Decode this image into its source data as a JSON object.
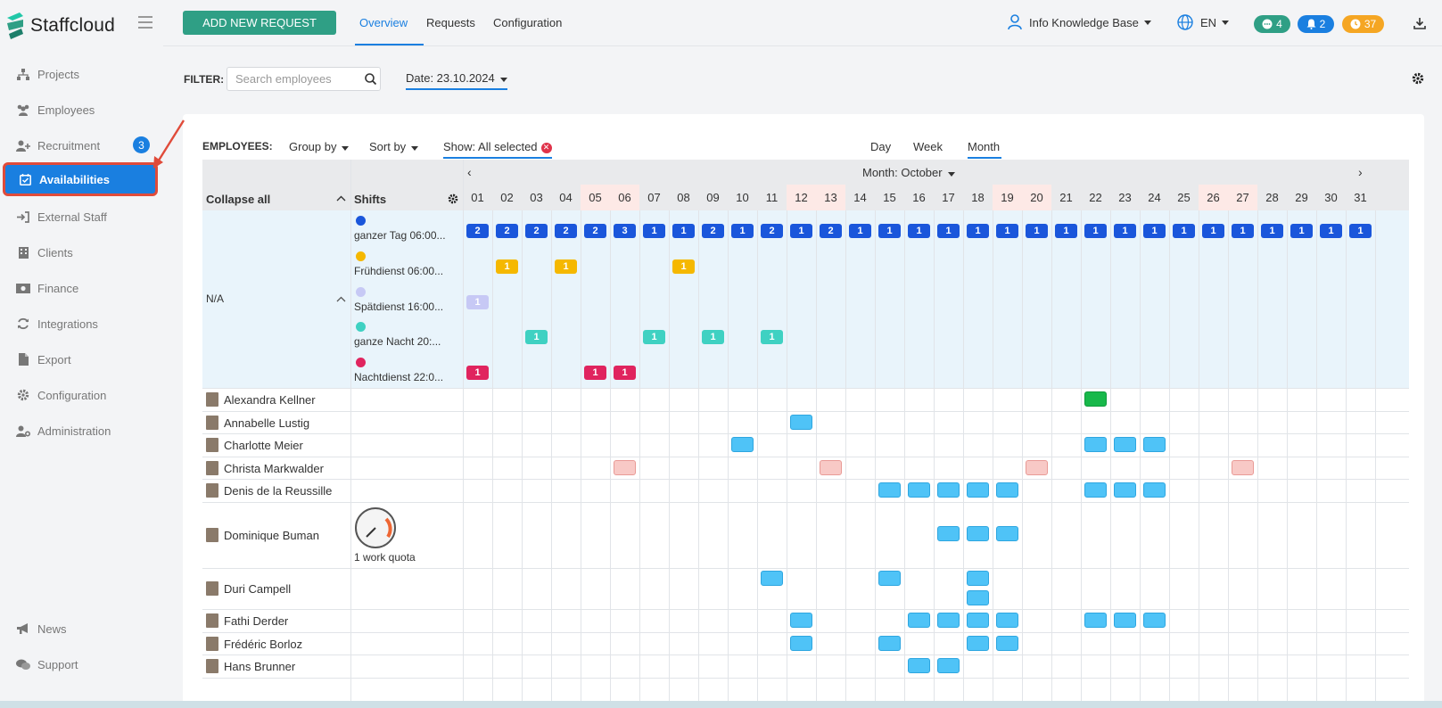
{
  "app": {
    "name": "Staffcloud"
  },
  "sidebar": {
    "items": [
      {
        "label": "Projects",
        "icon": "sitemap-icon"
      },
      {
        "label": "Employees",
        "icon": "users-icon"
      },
      {
        "label": "Recruitment",
        "icon": "user-plus-icon",
        "badge": "3"
      },
      {
        "label": "Availabilities",
        "icon": "calendar-check-icon",
        "active": true
      },
      {
        "label": "External Staff",
        "icon": "sign-in-icon"
      },
      {
        "label": "Clients",
        "icon": "building-icon"
      },
      {
        "label": "Finance",
        "icon": "money-icon"
      },
      {
        "label": "Integrations",
        "icon": "refresh-icon"
      },
      {
        "label": "Export",
        "icon": "file-icon"
      },
      {
        "label": "Configuration",
        "icon": "gear-icon"
      },
      {
        "label": "Administration",
        "icon": "user-gear-icon"
      }
    ],
    "bottom_items": [
      {
        "label": "News",
        "icon": "bullhorn-icon"
      },
      {
        "label": "Support",
        "icon": "comments-icon"
      }
    ]
  },
  "topbar": {
    "add_button": "ADD NEW REQUEST",
    "tabs": [
      "Overview",
      "Requests",
      "Configuration"
    ],
    "active_tab": "Overview",
    "user": "Info Knowledge Base",
    "language": "EN",
    "messages_count": "4",
    "notifications_count": "2",
    "timers_count": "37",
    "colors": {
      "messages": "#2f9f85",
      "notifications": "#1a7fe0",
      "timers": "#f5a623"
    }
  },
  "filter": {
    "label": "FILTER:",
    "search_placeholder": "Search employees",
    "date": "Date: 23.10.2024"
  },
  "toolbar": {
    "employees_label": "EMPLOYEES:",
    "group_by": "Group by",
    "sort_by": "Sort by",
    "show_label": "Show:",
    "show_value": "All selected",
    "views": [
      "Day",
      "Week",
      "Month"
    ],
    "active_view": "Month"
  },
  "calendar": {
    "collapse_all": "Collapse all",
    "shifts_label": "Shifts",
    "month_title": "Month: October",
    "days": [
      "01",
      "02",
      "03",
      "04",
      "05",
      "06",
      "07",
      "08",
      "09",
      "10",
      "11",
      "12",
      "13",
      "14",
      "15",
      "16",
      "17",
      "18",
      "19",
      "20",
      "21",
      "22",
      "23",
      "24",
      "25",
      "26",
      "27",
      "28",
      "29",
      "30",
      "31"
    ],
    "weekend_days": [
      "05",
      "06",
      "12",
      "13",
      "19",
      "20",
      "26",
      "27"
    ],
    "group_label": "N/A",
    "shifts": [
      {
        "name": "ganzer Tag 06:00...",
        "color": "#1a56db",
        "counts": [
          "2",
          "2",
          "2",
          "2",
          "2",
          "3",
          "1",
          "1",
          "2",
          "1",
          "2",
          "1",
          "2",
          "1",
          "1",
          "1",
          "1",
          "1",
          "1",
          "1",
          "1",
          "1",
          "1",
          "1",
          "1",
          "1",
          "1",
          "1",
          "1",
          "1",
          "1"
        ]
      },
      {
        "name": "Frühdienst 06:00...",
        "color": "#f5b800",
        "counts": [
          "",
          "1",
          "",
          "1",
          "",
          "",
          "",
          "1",
          "",
          "",
          "",
          "",
          "",
          "",
          "",
          "",
          "",
          "",
          "",
          "",
          "",
          "",
          "",
          "",
          "",
          "",
          "",
          "",
          "",
          "",
          ""
        ]
      },
      {
        "name": "Spätdienst 16:00...",
        "color": "#c7c9f5",
        "counts": [
          "1",
          "",
          "",
          "",
          "",
          "",
          "",
          "",
          "",
          "",
          "",
          "",
          "",
          "",
          "",
          "",
          "",
          "",
          "",
          "",
          "",
          "",
          "",
          "",
          "",
          "",
          "",
          "",
          "",
          "",
          ""
        ]
      },
      {
        "name": "ganze Nacht 20:...",
        "color": "#3fd1c2",
        "counts": [
          "",
          "",
          "1",
          "",
          "",
          "",
          "1",
          "",
          "1",
          "",
          "1",
          "",
          "",
          "",
          "",
          "",
          "",
          "",
          "",
          "",
          "",
          "",
          "",
          "",
          "",
          "",
          "",
          "",
          "",
          "",
          ""
        ]
      },
      {
        "name": "Nachtdienst 22:0...",
        "color": "#e0245e",
        "counts": [
          "1",
          "",
          "",
          "",
          "1",
          "1",
          "",
          "",
          "",
          "",
          "",
          "",
          "",
          "",
          "",
          "",
          "",
          "",
          "",
          "",
          "",
          "",
          "",
          "",
          "",
          "",
          "",
          "",
          "",
          "",
          ""
        ]
      }
    ],
    "employees": [
      {
        "name": "Alexandra Kellner",
        "blocks": [
          {
            "day": "22",
            "kind": "green"
          }
        ]
      },
      {
        "name": "Annabelle Lustig",
        "blocks": [
          {
            "day": "12",
            "kind": "blue"
          }
        ]
      },
      {
        "name": "Charlotte Meier",
        "blocks": [
          {
            "day": "10",
            "kind": "blue"
          },
          {
            "day": "22",
            "kind": "blue"
          },
          {
            "day": "23",
            "kind": "blue"
          },
          {
            "day": "24",
            "kind": "blue"
          }
        ]
      },
      {
        "name": "Christa Markwalder",
        "blocks": [
          {
            "day": "06",
            "kind": "pink"
          },
          {
            "day": "13",
            "kind": "pink"
          },
          {
            "day": "20",
            "kind": "pink"
          },
          {
            "day": "27",
            "kind": "pink"
          }
        ]
      },
      {
        "name": "Denis de la Reussille",
        "blocks": [
          {
            "day": "15",
            "kind": "blue"
          },
          {
            "day": "16",
            "kind": "blue"
          },
          {
            "day": "17",
            "kind": "blue"
          },
          {
            "day": "18",
            "kind": "blue"
          },
          {
            "day": "19",
            "kind": "blue"
          },
          {
            "day": "22",
            "kind": "blue"
          },
          {
            "day": "23",
            "kind": "blue"
          },
          {
            "day": "24",
            "kind": "blue"
          }
        ]
      },
      {
        "name": "Dominique Buman",
        "quota": "1 work quota",
        "blocks": [
          {
            "day": "17",
            "kind": "blue"
          },
          {
            "day": "18",
            "kind": "blue"
          },
          {
            "day": "19",
            "kind": "blue"
          }
        ]
      },
      {
        "name": "Duri Campell",
        "blocks": [
          {
            "day": "11",
            "kind": "blue"
          },
          {
            "day": "15",
            "kind": "blue"
          },
          {
            "day": "18",
            "kind": "blue"
          },
          {
            "day": "18",
            "kind": "blue",
            "second": true
          }
        ]
      },
      {
        "name": "Fathi Derder",
        "blocks": [
          {
            "day": "12",
            "kind": "blue"
          },
          {
            "day": "16",
            "kind": "blue"
          },
          {
            "day": "17",
            "kind": "blue"
          },
          {
            "day": "18",
            "kind": "blue"
          },
          {
            "day": "19",
            "kind": "blue"
          },
          {
            "day": "22",
            "kind": "blue"
          },
          {
            "day": "23",
            "kind": "blue"
          },
          {
            "day": "24",
            "kind": "blue"
          }
        ]
      },
      {
        "name": "Frédéric Borloz",
        "blocks": [
          {
            "day": "12",
            "kind": "blue"
          },
          {
            "day": "15",
            "kind": "blue"
          },
          {
            "day": "18",
            "kind": "blue"
          },
          {
            "day": "19",
            "kind": "blue"
          }
        ]
      },
      {
        "name": "Hans Brunner",
        "blocks": [
          {
            "day": "16",
            "kind": "blue"
          },
          {
            "day": "17",
            "kind": "blue"
          }
        ]
      }
    ]
  }
}
